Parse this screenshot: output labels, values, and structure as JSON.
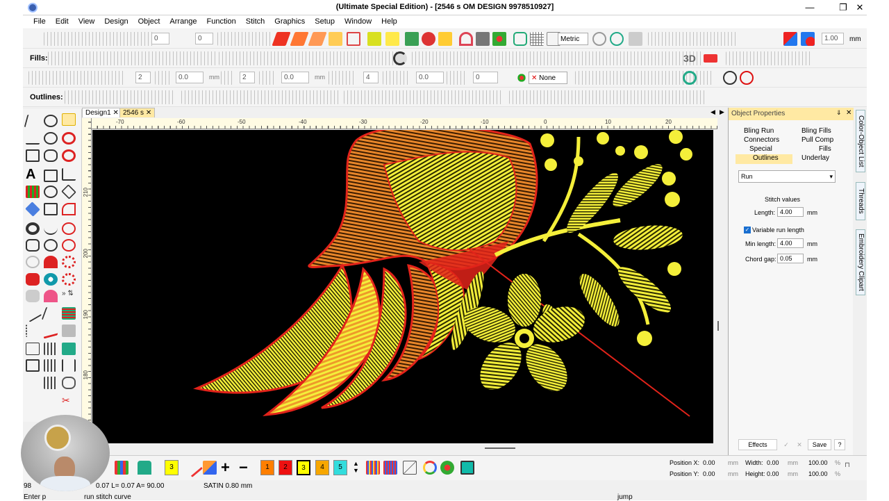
{
  "window": {
    "title": "(Ultimate Special Edition) - [2546 s        OM DESIGN 9978510927]",
    "controls": [
      "—",
      "❐",
      "✕"
    ]
  },
  "menu": [
    "File",
    "Edit",
    "View",
    "Design",
    "Object",
    "Arrange",
    "Function",
    "Stitch",
    "Graphics",
    "Setup",
    "Window",
    "Help"
  ],
  "toolbars": {
    "row1": {
      "spin_a": "0",
      "spin_b": "0",
      "units": "Metric",
      "zoom_value": "1.00",
      "zoom_unit": "mm"
    },
    "fills_label": "Fills:",
    "row2": {
      "threed": "3D"
    },
    "row3": {
      "spin_a": "2",
      "spin_b": "0.0",
      "unit_a": "mm",
      "spin_c": "2",
      "spin_d": "0.0",
      "unit_b": "mm",
      "spin_e": "4",
      "spin_f": "0.0",
      "spin_g": "0",
      "line_style": "None"
    },
    "outlines_label": "Outlines:"
  },
  "tabs": [
    "Design1",
    "2546 s"
  ],
  "ruler": {
    "h_labels": [
      "-70",
      "-60",
      "-50",
      "-40",
      "-30",
      "-20",
      "-10",
      "0",
      "10",
      "20"
    ],
    "v_labels": [
      "210",
      "200",
      "190",
      "180"
    ]
  },
  "properties": {
    "title": "Object Properties",
    "links": {
      "bling_run": "Bling Run",
      "bling_fills": "Bling Fills",
      "connectors": "Connectors",
      "pull_comp": "Pull Comp",
      "special": "Special",
      "fills": "Fills",
      "outlines": "Outlines",
      "underlay": "Underlay"
    },
    "type": "Run",
    "stitch_values": "Stitch values",
    "length_label": "Length:",
    "length_value": "4.00",
    "length_unit": "mm",
    "variable_label": "Variable run length",
    "variable_checked": true,
    "min_length_label": "Min length:",
    "min_length_value": "4.00",
    "min_length_unit": "mm",
    "chord_gap_label": "Chord gap:",
    "chord_gap_value": "0.05",
    "chord_gap_unit": "mm",
    "buttons": {
      "effects": "Effects",
      "check": "✓",
      "cross": "✕",
      "save": "Save",
      "help": "?"
    }
  },
  "side_tabs": [
    "Color-Object List",
    "Threads",
    "Embroidery Clipart"
  ],
  "palette": {
    "swatches": [
      {
        "label": "3",
        "color": "#ffff00"
      },
      {
        "label": "1",
        "color": "#ff7f00"
      },
      {
        "label": "2",
        "color": "#ee1111"
      },
      {
        "label": "3",
        "color": "#ffff00"
      },
      {
        "label": "4",
        "color": "#f7a700"
      },
      {
        "label": "5",
        "color": "#33dddd"
      }
    ]
  },
  "coords": {
    "pos_x_label": "Position X:",
    "pos_x": "0.00",
    "pos_x_unit": "mm",
    "pos_y_label": "Position Y:",
    "pos_y": "0.00",
    "pos_y_unit": "mm",
    "width_label": "Width:",
    "width": "0.00",
    "width_unit": "mm",
    "width_pct": "100.00",
    "width_pct_unit": "%",
    "height_label": "Height:",
    "height": "0.00",
    "height_unit": "mm",
    "height_pct": "100.00",
    "height_pct_unit": "%"
  },
  "status": {
    "line1_a": "98",
    "line1_b": "0.07 L=   0.07 A=  90.00",
    "stitch_info": "SATIN  0.80 mm",
    "line2_a": "Enter p",
    "line2_b": "run stitch curve",
    "jump": "jump"
  },
  "colors": {
    "canvas": "#000000",
    "yellow": "#f4ef3a",
    "orange": "#e8862a",
    "red": "#e2231a",
    "accent": "#ffe9a3"
  }
}
